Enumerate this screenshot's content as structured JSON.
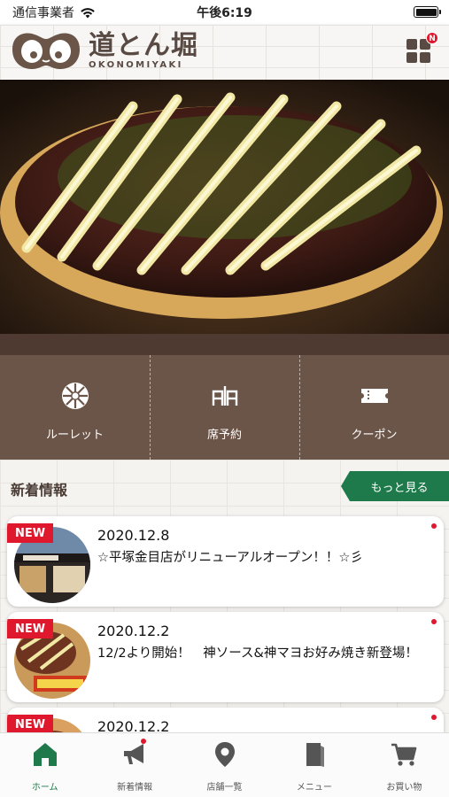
{
  "status_bar": {
    "carrier": "通信事業者",
    "time": "午後6:19"
  },
  "header": {
    "logo_jp": "道とん堀",
    "logo_en": "OKONOMIYAKI",
    "menu_badge": "N"
  },
  "quick_menu": [
    {
      "label": "ルーレット",
      "icon": "roulette-icon"
    },
    {
      "label": "席予約",
      "icon": "seat-reservation-icon"
    },
    {
      "label": "クーポン",
      "icon": "coupon-icon"
    }
  ],
  "news": {
    "title": "新着情報",
    "more_label": "もっと見る",
    "items": [
      {
        "badge": "NEW",
        "date": "2020.12.8",
        "text": "☆平塚金目店がリニューアルオープン！！☆彡"
      },
      {
        "badge": "NEW",
        "date": "2020.12.2",
        "text": "12/2より開始！　神ソース&神マヨお好み焼き新登場！"
      },
      {
        "badge": "NEW",
        "date": "2020.12.2",
        "text": ""
      }
    ]
  },
  "tab_bar": [
    {
      "label": "ホーム",
      "icon": "home-icon",
      "active": true
    },
    {
      "label": "新着情報",
      "icon": "megaphone-icon"
    },
    {
      "label": "店舗一覧",
      "icon": "map-pin-icon"
    },
    {
      "label": "メニュー",
      "icon": "menu-book-icon"
    },
    {
      "label": "お買い物",
      "icon": "cart-icon"
    }
  ],
  "colors": {
    "brand_brown": "#6b5448",
    "accent_green": "#1e7a4b",
    "badge_red": "#e0182d"
  }
}
